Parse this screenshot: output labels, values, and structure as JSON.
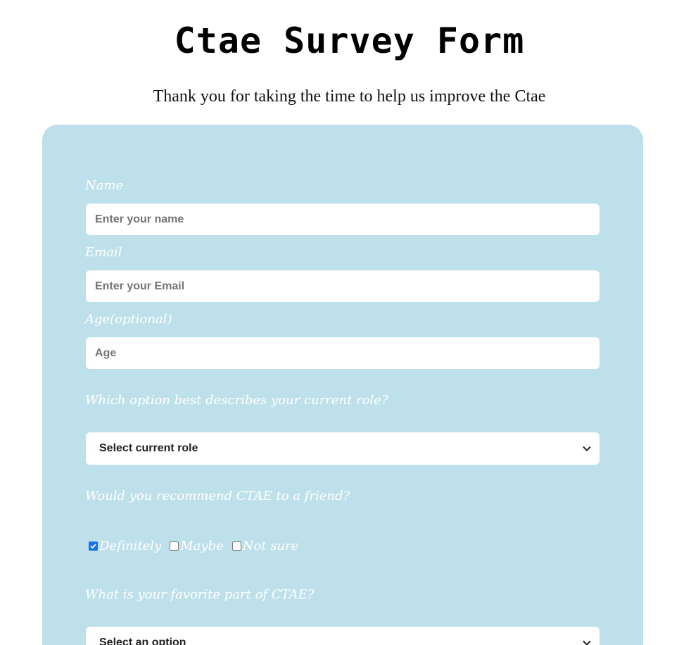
{
  "header": {
    "title": "Ctae Survey Form",
    "description": "Thank you for taking the time to help us improve the Ctae"
  },
  "form": {
    "name": {
      "label": "Name",
      "placeholder": "Enter your name",
      "value": ""
    },
    "email": {
      "label": "Email",
      "placeholder": "Enter your Email",
      "value": ""
    },
    "age": {
      "label": "Age(optional)",
      "placeholder": "Age",
      "value": ""
    },
    "role": {
      "question": "Which option best describes your current role?",
      "selected": "Select current role",
      "icon": "chevron-down-icon"
    },
    "recommend": {
      "question": "Would you recommend CTAE to a friend?",
      "options": [
        {
          "label": "Definitely",
          "checked": true
        },
        {
          "label": "Maybe",
          "checked": false
        },
        {
          "label": "Not sure",
          "checked": false
        }
      ]
    },
    "favorite": {
      "question": "What is your favorite part of CTAE?",
      "selected": "Select an option",
      "icon": "chevron-down-icon"
    }
  },
  "colors": {
    "form_background": "#bee0ea",
    "label_text": "#ffffff",
    "checkbox_checked": "#1a73e8"
  }
}
